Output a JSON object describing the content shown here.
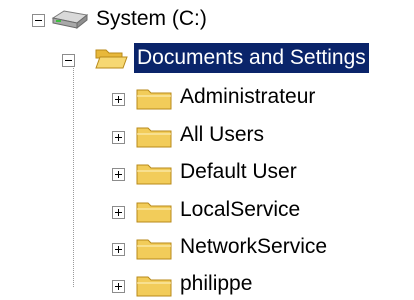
{
  "tree": {
    "root": {
      "label": "System (C:)",
      "icon": "drive-icon",
      "expander": "minus",
      "expanded": true
    },
    "folder": {
      "label": "Documents and Settings",
      "icon": "folder-open-icon",
      "expander": "minus",
      "expanded": true,
      "selected": true
    },
    "children": [
      {
        "label": "Administrateur",
        "icon": "folder-icon",
        "expander": "plus"
      },
      {
        "label": "All Users",
        "icon": "folder-icon",
        "expander": "plus"
      },
      {
        "label": "Default User",
        "icon": "folder-icon",
        "expander": "plus"
      },
      {
        "label": "LocalService",
        "icon": "folder-icon",
        "expander": "plus"
      },
      {
        "label": "NetworkService",
        "icon": "folder-icon",
        "expander": "plus"
      },
      {
        "label": "philippe",
        "icon": "folder-icon",
        "expander": "plus"
      }
    ]
  },
  "colors": {
    "selection": "#0a246a",
    "selection_text": "#ffffff",
    "folder": "#f2cc5a"
  }
}
